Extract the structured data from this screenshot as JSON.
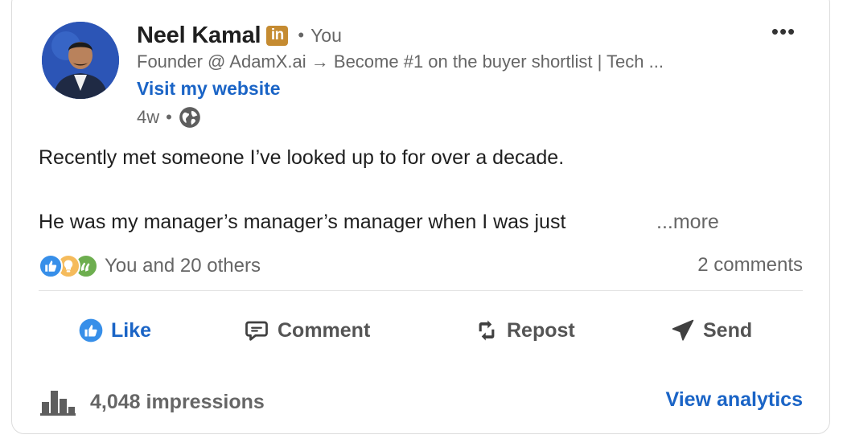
{
  "post": {
    "author": {
      "name": "Neel Kamal",
      "badge": "in",
      "separator": "•",
      "relation": "You",
      "headline": "Founder @ AdamX.ai → Become #1 on the buyer shortlist | Tech ...",
      "website_label": "Visit my website",
      "time": "4w",
      "time_separator": "•",
      "visibility_icon": "globe-icon"
    },
    "menu_label": "•••",
    "body": {
      "line1": "Recently met someone I’ve looked up to for over a decade.",
      "line2": "He was my manager’s manager’s manager when I was just",
      "see_more": "...more"
    },
    "social": {
      "reaction_icons": [
        "like-icon",
        "insightful-icon",
        "celebrate-icon"
      ],
      "reactions_text": "You and 20 others",
      "comments_text": "2 comments"
    },
    "actions": {
      "like": "Like",
      "comment": "Comment",
      "repost": "Repost",
      "send": "Send"
    },
    "analytics": {
      "impressions": "4,048 impressions",
      "view_analytics": "View analytics"
    },
    "colors": {
      "link_blue": "#1a64c6",
      "badge_gold": "#c58b31",
      "muted_text": "#666666"
    }
  }
}
